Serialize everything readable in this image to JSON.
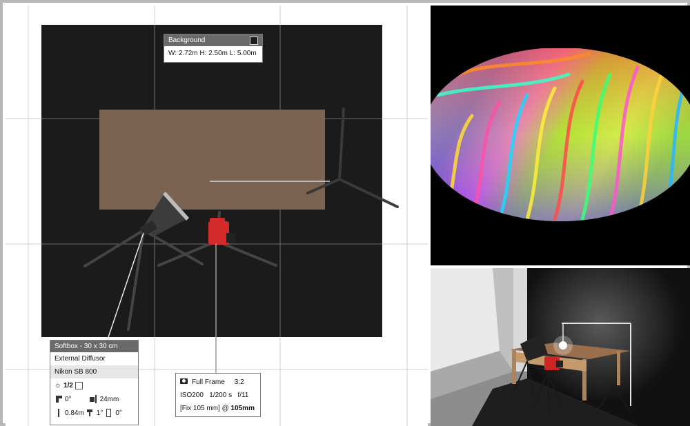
{
  "background_panel": {
    "title": "Background",
    "dimensions": "W: 2.72m H: 2.50m L: 5.00m"
  },
  "light_panel": {
    "title": "Softbox - 30 x 30 cm",
    "modifier": "External Diffusor",
    "flash": "Nikon SB 800",
    "power": "1/2",
    "tilt": "0°",
    "zoom": "24mm",
    "height": "0.84m",
    "rotation": "1°",
    "pan": "0°"
  },
  "camera_panel": {
    "sensor": "Full Frame",
    "ratio": "3:2",
    "iso": "ISO200",
    "shutter": "1/200 s",
    "aperture": "f/11",
    "lens": "[Fix 105 mm] @ ",
    "focal": "105mm"
  },
  "colors": {
    "backdrop": "#1b1b1b",
    "table": "#7b6352",
    "camera": "#d42a2a",
    "panel_header": "#6a6a6a"
  },
  "icons": [
    "camera-icon",
    "power-icon",
    "tilt-icon",
    "zoom-icon",
    "height-icon",
    "rotation-icon",
    "pan-icon"
  ]
}
